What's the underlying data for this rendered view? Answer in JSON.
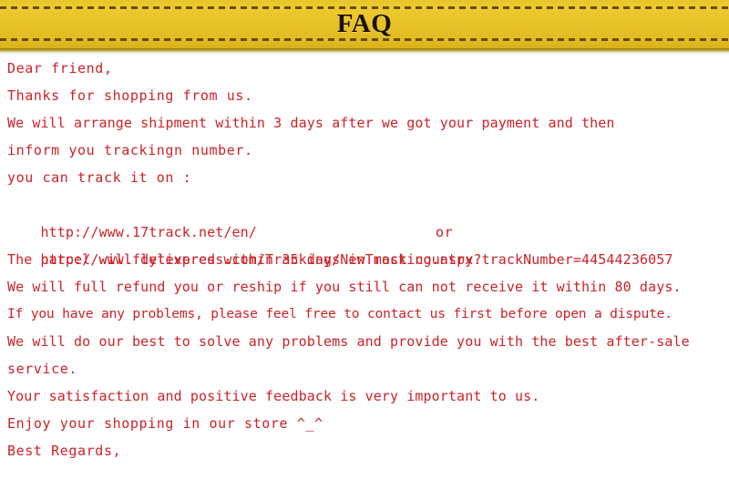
{
  "banner": {
    "title": "FAQ",
    "background_color": "#e6c228",
    "stitch_color": "#6b4a13",
    "title_color": "#18120a"
  },
  "body": {
    "text_color": "#cc2229",
    "lines": [
      {
        "id": "greeting",
        "text": "Dear friend,"
      },
      {
        "id": "thanks",
        "text": "Thanks for shopping from us."
      },
      {
        "id": "shipment-time",
        "text": "We will arrange shipment within 3 days after we got your payment and then"
      },
      {
        "id": "inform-tracking",
        "text": "inform you trackingn number."
      },
      {
        "id": "track-prompt",
        "text": "you can track it on :"
      },
      {
        "id": "delivery-time",
        "text": "The parcel will delivered within 35 days in most country."
      },
      {
        "id": "refund-policy",
        "text": "We will full refund you or reship if you still can not receive it within 80 days."
      },
      {
        "id": "dispute-notice",
        "text": "If you have any problems, please feel free to contact us first before open a dispute."
      },
      {
        "id": "best-effort",
        "text": "We will do our best to solve any problems and provide you with the best after-sale"
      },
      {
        "id": "service-word",
        "text": "service."
      },
      {
        "id": "feedback-note",
        "text": "Your satisfaction and positive feedback is very important to us."
      },
      {
        "id": "enjoy-shopping",
        "text": "Enjoy your shopping in our store ^_^"
      },
      {
        "id": "sign-off",
        "text": "Best Regards,"
      }
    ],
    "tracking_links": {
      "link_one": "http://www.17track.net/en/",
      "separator": "or",
      "link_two": "http://www.flytexpress.com/Tracking/NewTracking.aspx?trackNumber=44544236057"
    }
  }
}
